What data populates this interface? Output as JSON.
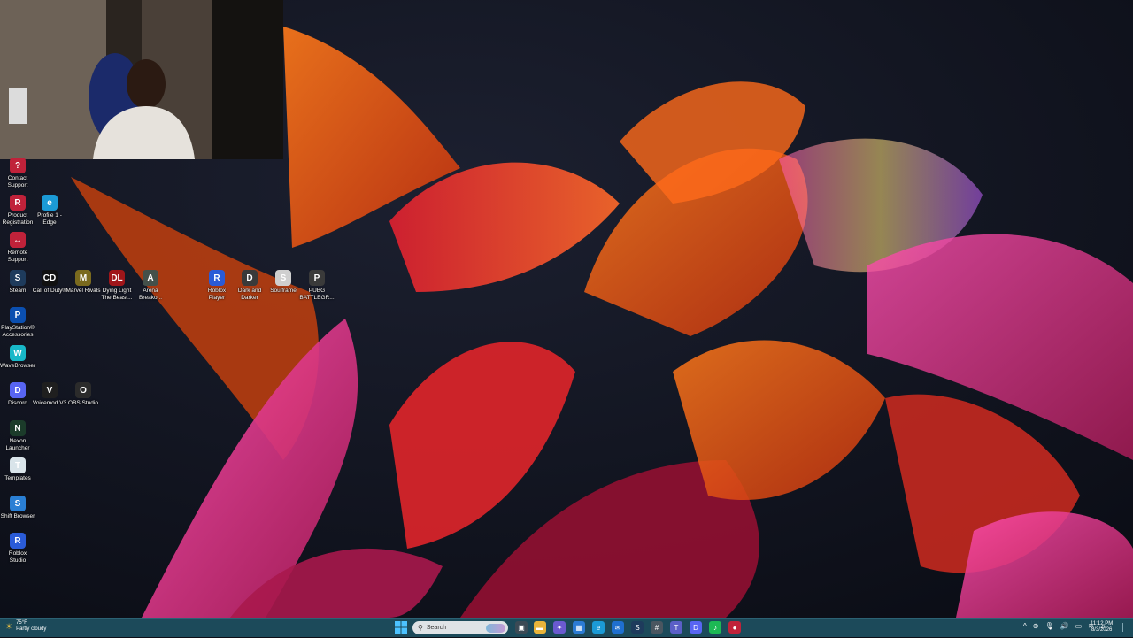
{
  "desktop": {
    "icons": [
      {
        "label": "Contact Support",
        "name": "contact-support-icon",
        "bg": "#c0223a",
        "glyph": "?"
      },
      {
        "label": "Product Registration",
        "name": "product-registration-icon",
        "bg": "#c0223a",
        "glyph": "R"
      },
      {
        "label": "Profile 1 - Edge",
        "name": "edge-icon",
        "bg": "#1b9ad6",
        "glyph": "e"
      },
      {
        "label": "Remote Support",
        "name": "remote-support-icon",
        "bg": "#c0223a",
        "glyph": "↔"
      },
      {
        "label": "Steam",
        "name": "steam-icon",
        "bg": "#1e3b5c",
        "glyph": "S"
      },
      {
        "label": "Call of Duty®",
        "name": "call-of-duty-icon",
        "bg": "#111111",
        "glyph": "CD"
      },
      {
        "label": "Marvel Rivals",
        "name": "marvel-rivals-icon",
        "bg": "#7a6a1e",
        "glyph": "M"
      },
      {
        "label": "Dying Light The Beast...",
        "name": "dying-light-icon",
        "bg": "#a0161a",
        "glyph": "DL"
      },
      {
        "label": "Arena Breako...",
        "name": "arena-breakout-icon",
        "bg": "#44504a",
        "glyph": "A"
      },
      {
        "label": "Roblox Player",
        "name": "roblox-player-icon",
        "bg": "#2a5bd7",
        "glyph": "R"
      },
      {
        "label": "Dark and Darker",
        "name": "dark-and-darker-icon",
        "bg": "#3a3a3a",
        "glyph": "D"
      },
      {
        "label": "Soulframe",
        "name": "soulframe-icon",
        "bg": "#cfcfcf",
        "glyph": "S"
      },
      {
        "label": "PUBG BATTLEGR...",
        "name": "pubg-icon",
        "bg": "#3a3a3a",
        "glyph": "P"
      },
      {
        "label": "PlayStation® Accessories",
        "name": "playstation-accessories-icon",
        "bg": "#0b4fb0",
        "glyph": "P"
      },
      {
        "label": "WaveBrowser",
        "name": "wavebrowser-icon",
        "bg": "#18b8c8",
        "glyph": "W"
      },
      {
        "label": "Discord",
        "name": "discord-icon",
        "bg": "#5865f2",
        "glyph": "D"
      },
      {
        "label": "Voicemod V3",
        "name": "voicemod-icon",
        "bg": "#1f1f1f",
        "glyph": "V"
      },
      {
        "label": "OBS Studio",
        "name": "obs-studio-icon",
        "bg": "#2b2b2b",
        "glyph": "O"
      },
      {
        "label": "Nexon Launcher",
        "name": "nexon-launcher-icon",
        "bg": "#1b3b2a",
        "glyph": "N"
      },
      {
        "label": "Templates",
        "name": "templates-icon",
        "bg": "#d9e4ea",
        "glyph": "T"
      },
      {
        "label": "Shift Browser",
        "name": "shift-browser-icon",
        "bg": "#2a7fd4",
        "glyph": "S"
      },
      {
        "label": "Roblox Studio",
        "name": "roblox-studio-icon",
        "bg": "#2a5bd7",
        "glyph": "R"
      }
    ]
  },
  "taskbar": {
    "weather_temp": "75°F",
    "weather_desc": "Partly cloudy",
    "search_placeholder": "Search",
    "clock_time": "11:12 PM",
    "clock_date": "8/3/2026",
    "pinned": [
      {
        "name": "task-view-icon",
        "bg": "#3b4a55",
        "glyph": "▣"
      },
      {
        "name": "file-explorer-icon",
        "bg": "#e8b43a",
        "glyph": "▬"
      },
      {
        "name": "copilot-icon",
        "bg": "#6a5ad0",
        "glyph": "✦"
      },
      {
        "name": "microsoft-store-icon",
        "bg": "#2b7bd3",
        "glyph": "▦"
      },
      {
        "name": "edge-taskbar-icon",
        "bg": "#1b9ad6",
        "glyph": "e"
      },
      {
        "name": "mail-icon",
        "bg": "#1f6fcf",
        "glyph": "✉"
      },
      {
        "name": "steam-taskbar-icon",
        "bg": "#1e3b5c",
        "glyph": "S"
      },
      {
        "name": "calculator-icon",
        "bg": "#4a5660",
        "glyph": "#"
      },
      {
        "name": "teams-icon",
        "bg": "#5b5fc7",
        "glyph": "T"
      },
      {
        "name": "discord-taskbar-icon",
        "bg": "#5865f2",
        "glyph": "D"
      },
      {
        "name": "spotify-icon",
        "bg": "#1db954",
        "glyph": "♪"
      },
      {
        "name": "obs-taskbar-icon",
        "bg": "#c0223a",
        "glyph": "●"
      }
    ],
    "tray": [
      {
        "name": "show-hidden-icons-chevron-icon",
        "glyph": "^"
      },
      {
        "name": "network-icon",
        "glyph": "⊕"
      },
      {
        "name": "microphone-icon",
        "glyph": "🎙"
      },
      {
        "name": "volume-icon",
        "glyph": "🔊"
      },
      {
        "name": "monitor-icon",
        "glyph": "▭"
      },
      {
        "name": "wifi-icon",
        "glyph": "≋"
      },
      {
        "name": "speaker-icon",
        "glyph": "♫"
      }
    ]
  }
}
